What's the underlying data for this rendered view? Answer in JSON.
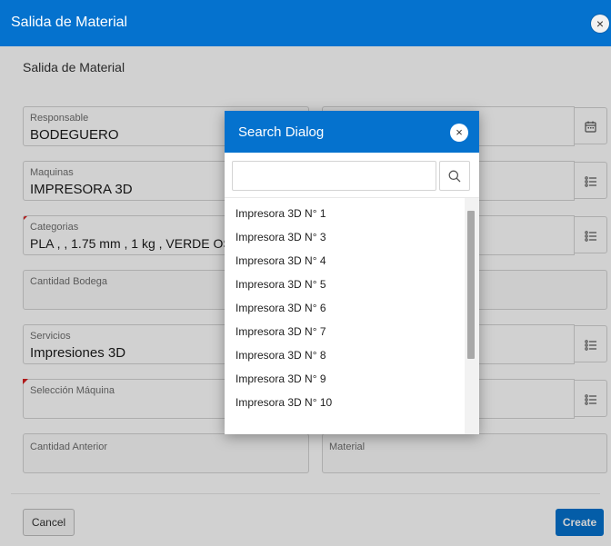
{
  "window": {
    "title": "Salida de Material",
    "close_symbol": "×"
  },
  "form": {
    "subtitle": "Salida de Material",
    "fields": {
      "responsable": {
        "label": "Responsable",
        "value": "BODEGUERO"
      },
      "maquinas": {
        "label": "Maquinas",
        "value": "IMPRESORA 3D"
      },
      "categorias": {
        "label": "Categorias",
        "value": "PLA ,    , 1.75 mm , 1 kg , VERDE OSCURO"
      },
      "cantidad_bodega": {
        "label": "Cantidad Bodega",
        "value": ""
      },
      "servicios": {
        "label": "Servicios",
        "value": "Impresiones 3D"
      },
      "seleccion_maquina": {
        "label": "Selección Máquina",
        "value": ""
      },
      "cantidad_anterior": {
        "label": "Cantidad Anterior",
        "value": ""
      },
      "material": {
        "label": "Material",
        "value": ""
      }
    }
  },
  "footer": {
    "cancel_label": "Cancel",
    "create_label": "Create"
  },
  "search_dialog": {
    "title": "Search Dialog",
    "close_symbol": "×",
    "search_value": "",
    "items": [
      "Impresora 3D N° 1",
      "Impresora 3D N° 3",
      "Impresora 3D N° 4",
      "Impresora 3D N° 5",
      "Impresora 3D N° 6",
      "Impresora 3D N° 7",
      "Impresora 3D N° 8",
      "Impresora 3D N° 9",
      "Impresora 3D N° 10"
    ]
  },
  "icons": {
    "calendar": "calendar-icon",
    "list": "list-icon",
    "search": "search-icon",
    "close": "close-icon"
  },
  "colors": {
    "header_blue": "#0572ce",
    "required_marker": "#d61f1f",
    "overlay": "rgba(0,0,0,0.18)"
  }
}
